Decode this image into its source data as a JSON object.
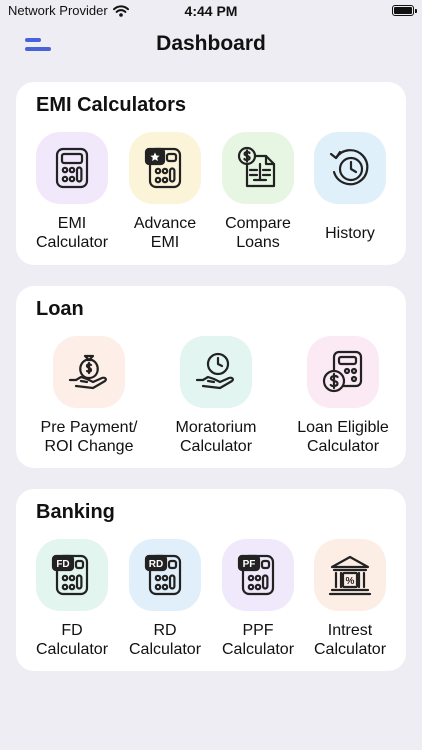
{
  "status_bar": {
    "carrier": "Network Provider",
    "time": "4:44 PM"
  },
  "header": {
    "title": "Dashboard"
  },
  "sections": {
    "emi": {
      "title": "EMI Calculators",
      "items": [
        {
          "label": "EMI\nCalculator",
          "icon": "calculator-icon",
          "bg": "#f1e9fb"
        },
        {
          "label": "Advance\nEMI",
          "icon": "star-calculator-icon",
          "bg": "#fcf4d9"
        },
        {
          "label": "Compare\nLoans",
          "icon": "dollar-document-icon",
          "bg": "#e6f6e2"
        },
        {
          "label": "History",
          "icon": "history-clock-icon",
          "bg": "#e0f0fb"
        }
      ]
    },
    "loan": {
      "title": "Loan",
      "items": [
        {
          "label": "Pre Payment/\nROI Change",
          "icon": "money-bag-hand-icon",
          "bg": "#fdeee8"
        },
        {
          "label": "Moratorium\nCalculator",
          "icon": "clock-hand-icon",
          "bg": "#e2f5f1"
        },
        {
          "label": "Loan Eligible\nCalculator",
          "icon": "calculator-dollar-icon",
          "bg": "#fbe9f3"
        }
      ]
    },
    "banking": {
      "title": "Banking",
      "items": [
        {
          "label": "FD\nCalculator",
          "icon": "fd-calculator-icon",
          "bg": "#e2f5ef",
          "badge": "FD"
        },
        {
          "label": "RD\nCalculator",
          "icon": "rd-calculator-icon",
          "bg": "#e0effa",
          "badge": "RD"
        },
        {
          "label": "PPF\nCalculator",
          "icon": "ppf-calculator-icon",
          "bg": "#f0e9fb",
          "badge": "PF"
        },
        {
          "label": "Intrest\nCalculator",
          "icon": "bank-icon",
          "bg": "#fdeee5",
          "badge": "%"
        }
      ]
    }
  }
}
